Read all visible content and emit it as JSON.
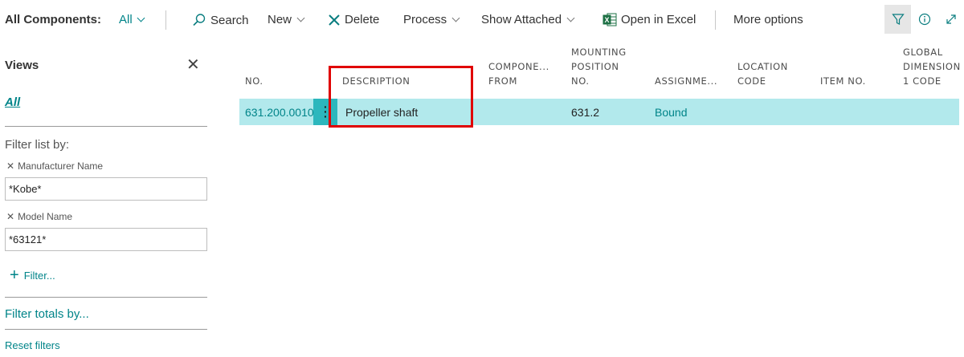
{
  "toolbar": {
    "title": "All Components:",
    "view_selector": "All",
    "search_label": "Search",
    "new_label": "New",
    "delete_label": "Delete",
    "process_label": "Process",
    "show_attached_label": "Show Attached",
    "open_in_excel_label": "Open in Excel",
    "more_options_label": "More options",
    "icons": [
      "filter-icon",
      "info-icon",
      "expand-icon"
    ]
  },
  "views_pane": {
    "title": "Views",
    "selected_view": "All",
    "filter_list_by": "Filter list by:",
    "filters": [
      {
        "label": "Manufacturer Name",
        "value": "*Kobe*"
      },
      {
        "label": "Model Name",
        "value": "*63121*"
      }
    ],
    "add_filter": "Filter...",
    "filter_totals_by": "Filter totals by...",
    "reset_filters": "Reset filters"
  },
  "grid": {
    "columns": [
      {
        "line1": "",
        "line2": "",
        "line3": "NO."
      },
      {
        "line1": "",
        "line2": "",
        "line3": "DESCRIPTION"
      },
      {
        "line1": "",
        "line2": "COMPONE...",
        "line3": "FROM"
      },
      {
        "line1": "MOUNTING",
        "line2": "POSITION",
        "line3": "NO."
      },
      {
        "line1": "",
        "line2": "",
        "line3": "ASSIGNME..."
      },
      {
        "line1": "",
        "line2": "LOCATION",
        "line3": "CODE"
      },
      {
        "line1": "",
        "line2": "",
        "line3": "ITEM NO."
      },
      {
        "line1": "GLOBAL",
        "line2": "DIMENSION",
        "line3": "1 CODE"
      }
    ],
    "rows": [
      {
        "no": "631.200.0010",
        "description": "Propeller shaft",
        "component_from": "",
        "mounting_position_no": "631.2",
        "assignment": "Bound",
        "location_code": "",
        "item_no": "",
        "global_dimension_1_code": ""
      }
    ]
  },
  "colors": {
    "accent": "#008489",
    "selected_row": "#b2e9ec",
    "row_marker": "#2cb7bd",
    "highlight_box": "#e00000"
  }
}
